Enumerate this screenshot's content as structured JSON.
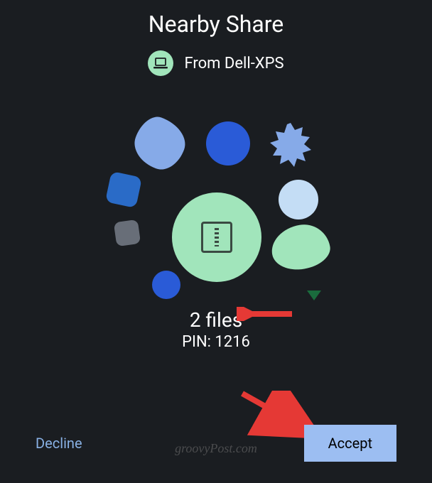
{
  "title": "Nearby Share",
  "from_label": "From Dell-XPS",
  "device_icon": "laptop-icon",
  "file_icon": "zip-archive-icon",
  "files_text": "2 files",
  "pin_text": "PIN: 1216",
  "buttons": {
    "decline": "Decline",
    "accept": "Accept"
  },
  "watermark": "groovyPost.com",
  "colors": {
    "accent_green": "#a1e5bb",
    "blue_primary": "#2a5bd7",
    "blue_light": "#86aae8",
    "accept_bg": "#9cbef2",
    "decline_text": "#88b0e3"
  }
}
